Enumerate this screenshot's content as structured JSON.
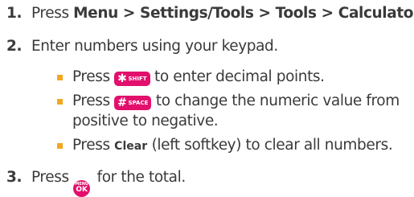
{
  "steps": [
    {
      "number": "1.",
      "prefix": "Press ",
      "bold": "Menu > Settings/Tools > Tools > Calculator",
      "suffix": "."
    },
    {
      "number": "2.",
      "text": "Enter numbers using your keypad.",
      "bullets": [
        {
          "pre": "Press ",
          "key_symbol": "✱",
          "key_text": "SHIFT",
          "post": " to enter decimal points."
        },
        {
          "pre": "Press ",
          "key_symbol": "#",
          "key_text": "SPACE",
          "post": " to change the numeric value from",
          "continuation": "positive to negative."
        },
        {
          "pre": "Press ",
          "bold": "Clear",
          "post": " (left softkey) to clear all numbers."
        }
      ]
    },
    {
      "number": "3.",
      "prefix": "Press ",
      "button_top": "MENU",
      "button_bottom": "OK",
      "suffix": " for the total."
    }
  ],
  "colors": {
    "text": "#3a3a3a",
    "bullet": "#f0a81e",
    "key": "#e2106c"
  },
  "icons": [
    "star-shift-key-icon",
    "pound-space-key-icon",
    "menu-ok-button-icon",
    "square-bullet-icon"
  ]
}
